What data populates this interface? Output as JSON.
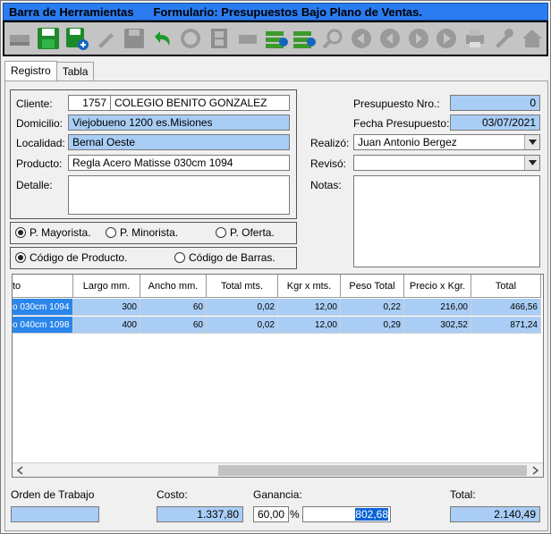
{
  "titlebar": {
    "left": "Barra de Herramientas",
    "right": "Formulario: Presupuestos Bajo Plano de Ventas."
  },
  "toolbar": {
    "buttons": [
      "new-icon",
      "save-icon",
      "save-add-icon",
      "edit-icon",
      "save-disabled-icon",
      "undo-icon",
      "refresh-icon",
      "film-icon",
      "minus-icon",
      "add-row-icon",
      "remove-row-icon",
      "search-icon",
      "first-icon",
      "prev-icon",
      "next-icon",
      "last-icon",
      "print-icon",
      "tools-icon",
      "home-icon"
    ]
  },
  "tabs": [
    "Registro",
    "Tabla"
  ],
  "form": {
    "cliente_label": "Cliente:",
    "cliente_code": "1757",
    "cliente_name": "COLEGIO BENITO GONZALEZ",
    "domicilio_label": "Domicilio:",
    "domicilio": "Viejobueno 1200 es.Misiones",
    "localidad_label": "Localidad:",
    "localidad": "Bernal Oeste",
    "producto_label": "Producto:",
    "producto": "Regla Acero Matisse 030cm 1094",
    "detalle_label": "Detalle:",
    "detalle": "",
    "presupuesto_label": "Presupuesto Nro.:",
    "presupuesto": "0",
    "fecha_label": "Fecha Presupuesto:",
    "fecha": "03/07/2021",
    "realizo_label": "Realizó:",
    "realizo": "Juan Antonio Bergez",
    "reviso_label": "Revisó:",
    "reviso": "",
    "notas_label": "Notas:",
    "notas": ""
  },
  "prices": {
    "mayorista": "P. Mayorista.",
    "minorista": "P. Minorista.",
    "oferta": "P. Oferta."
  },
  "codes": {
    "producto": "Código de Producto.",
    "barras": "Código de Barras."
  },
  "grid": {
    "headers": [
      "to",
      "Largo mm.",
      "Ancho mm.",
      "Total mts.",
      "Kgr x mts.",
      "Peso Total",
      "Precio x Kgr.",
      "Total"
    ],
    "rows": [
      [
        "o 030cm 1094",
        "300",
        "60",
        "0,02",
        "12,00",
        "0,22",
        "216,00",
        "466,56"
      ],
      [
        "o 040cm 1098",
        "400",
        "60",
        "0,02",
        "12,00",
        "0,29",
        "302,52",
        "871,24"
      ]
    ]
  },
  "footer": {
    "orden_label": "Orden de Trabajo",
    "orden": "",
    "costo_label": "Costo:",
    "costo": "1.337,80",
    "ganancia_label": "Ganancia:",
    "ganancia_pct": "60,00",
    "pct_sign": "%",
    "ganancia_val": "802,68",
    "total_label": "Total:",
    "total": "2.140,49"
  }
}
